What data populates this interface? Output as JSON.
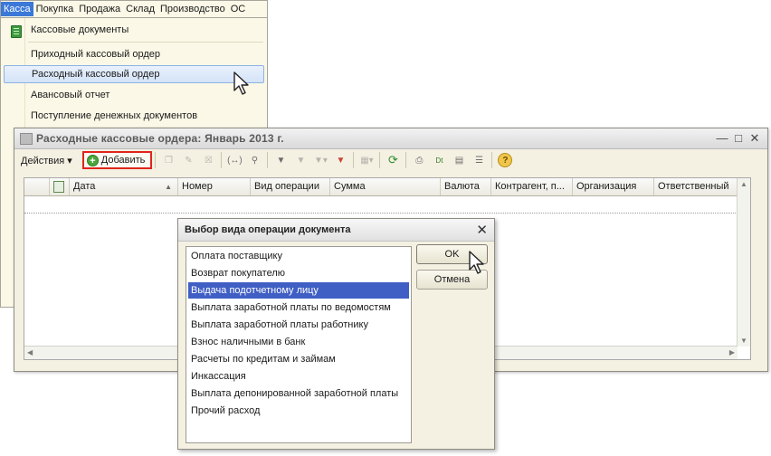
{
  "menu": {
    "items": [
      "Касса",
      "Покупка",
      "Продажа",
      "Склад",
      "Производство",
      "ОС"
    ],
    "active_index": 0
  },
  "dropdown": {
    "items": [
      "Кассовые документы",
      "Приходный кассовый ордер",
      "Расходный кассовый ордер",
      "Авансовый отчет",
      "Поступление денежных документов"
    ],
    "highlighted_index": 2
  },
  "list_window": {
    "title": "Расходные кассовые ордера: Январь 2013 г.",
    "toolbar": {
      "actions_label": "Действия",
      "add_label": "Добавить"
    },
    "columns": [
      "Дата",
      "Номер",
      "Вид операции",
      "Сумма",
      "Валюта",
      "Контрагент, п...",
      "Организация",
      "Ответственный"
    ]
  },
  "dialog": {
    "title": "Выбор вида операции документа",
    "options": [
      "Оплата поставщику",
      "Возврат покупателю",
      "Выдача подотчетному лицу",
      "Выплата заработной платы по ведомостям",
      "Выплата заработной платы работнику",
      "Взнос наличными в банк",
      "Расчеты по кредитам и займам",
      "Инкассация",
      "Выплата депонированной заработной платы",
      "Прочий расход"
    ],
    "selected_index": 2,
    "ok_label": "OK",
    "cancel_label": "Отмена"
  },
  "colors": {
    "accent": "#3b78d8",
    "selection": "#3f5fc4",
    "highlight_border": "#e0251b"
  }
}
